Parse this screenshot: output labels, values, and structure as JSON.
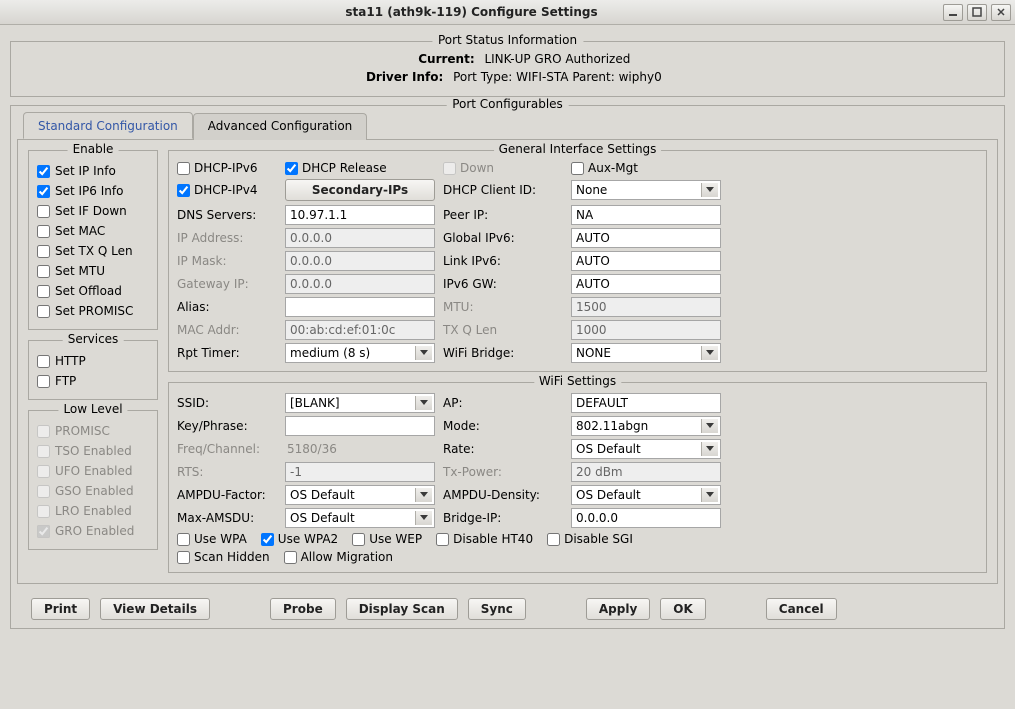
{
  "window": {
    "title": "sta11  (ath9k-119) Configure Settings"
  },
  "port_status": {
    "title": "Port Status Information",
    "current_label": "Current:",
    "current_value": "LINK-UP GRO  Authorized",
    "driver_label": "Driver Info:",
    "driver_value": "Port Type: WIFI-STA   Parent: wiphy0"
  },
  "configurables_title": "Port Configurables",
  "tabs": {
    "standard": "Standard Configuration",
    "advanced": "Advanced Configuration"
  },
  "enable": {
    "legend": "Enable",
    "items": [
      {
        "label": "Set IP Info",
        "checked": true,
        "enabled": true
      },
      {
        "label": "Set IP6 Info",
        "checked": true,
        "enabled": true
      },
      {
        "label": "Set IF Down",
        "checked": false,
        "enabled": true
      },
      {
        "label": "Set MAC",
        "checked": false,
        "enabled": true
      },
      {
        "label": "Set TX Q Len",
        "checked": false,
        "enabled": true
      },
      {
        "label": "Set MTU",
        "checked": false,
        "enabled": true
      },
      {
        "label": "Set Offload",
        "checked": false,
        "enabled": true
      },
      {
        "label": "Set PROMISC",
        "checked": false,
        "enabled": true
      }
    ]
  },
  "services": {
    "legend": "Services",
    "items": [
      {
        "label": "HTTP",
        "checked": false,
        "enabled": true
      },
      {
        "label": "FTP",
        "checked": false,
        "enabled": true
      }
    ]
  },
  "lowlevel": {
    "legend": "Low Level",
    "items": [
      {
        "label": "PROMISC",
        "checked": false,
        "enabled": false
      },
      {
        "label": "TSO Enabled",
        "checked": false,
        "enabled": false
      },
      {
        "label": "UFO Enabled",
        "checked": false,
        "enabled": false
      },
      {
        "label": "GSO Enabled",
        "checked": false,
        "enabled": false
      },
      {
        "label": "LRO Enabled",
        "checked": false,
        "enabled": false
      },
      {
        "label": "GRO Enabled",
        "checked": true,
        "enabled": false
      }
    ]
  },
  "general": {
    "title": "General Interface Settings",
    "dhcp_ipv6": {
      "label": "DHCP-IPv6",
      "checked": false,
      "enabled": true
    },
    "dhcp_release": {
      "label": "DHCP Release",
      "checked": true,
      "enabled": true
    },
    "down": {
      "label": "Down",
      "checked": false,
      "enabled": false
    },
    "aux_mgt": {
      "label": "Aux-Mgt",
      "checked": false,
      "enabled": true
    },
    "dhcp_ipv4": {
      "label": "DHCP-IPv4",
      "checked": true,
      "enabled": true
    },
    "secondary_ips_btn": "Secondary-IPs",
    "dhcp_client_id_label": "DHCP Client ID:",
    "dhcp_client_id_value": "None",
    "dns_label": "DNS Servers:",
    "dns_value": "10.97.1.1",
    "peer_label": "Peer IP:",
    "peer_value": "NA",
    "ip_label": "IP Address:",
    "ip_value": "0.0.0.0",
    "gipv6_label": "Global IPv6:",
    "gipv6_value": "AUTO",
    "mask_label": "IP Mask:",
    "mask_value": "0.0.0.0",
    "lipv6_label": "Link IPv6:",
    "lipv6_value": "AUTO",
    "gw_label": "Gateway IP:",
    "gw_value": "0.0.0.0",
    "ipv6gw_label": "IPv6 GW:",
    "ipv6gw_value": "AUTO",
    "alias_label": "Alias:",
    "alias_value": "",
    "mtu_label": "MTU:",
    "mtu_value": "1500",
    "mac_label": "MAC Addr:",
    "mac_value": "00:ab:cd:ef:01:0c",
    "txq_label": "TX Q Len",
    "txq_value": "1000",
    "rpt_label": "Rpt Timer:",
    "rpt_value": "medium  (8 s)",
    "bridge_label": "WiFi Bridge:",
    "bridge_value": "NONE"
  },
  "wifi": {
    "title": "WiFi Settings",
    "ssid_label": "SSID:",
    "ssid_value": "[BLANK]",
    "ap_label": "AP:",
    "ap_value": "DEFAULT",
    "key_label": "Key/Phrase:",
    "key_value": "",
    "mode_label": "Mode:",
    "mode_value": "802.11abgn",
    "freq_label": "Freq/Channel:",
    "freq_value": "5180/36",
    "rate_label": "Rate:",
    "rate_value": "OS Default",
    "rts_label": "RTS:",
    "rts_value": "-1",
    "txpower_label": "Tx-Power:",
    "txpower_value": "20 dBm",
    "ampduf_label": "AMPDU-Factor:",
    "ampduf_value": "OS Default",
    "ampdud_label": "AMPDU-Density:",
    "ampdud_value": "OS Default",
    "maxamsdu_label": "Max-AMSDU:",
    "maxamsdu_value": "OS Default",
    "bridgeip_label": "Bridge-IP:",
    "bridgeip_value": "0.0.0.0",
    "cb": {
      "use_wpa": {
        "label": "Use WPA",
        "checked": false
      },
      "use_wpa2": {
        "label": "Use WPA2",
        "checked": true
      },
      "use_wep": {
        "label": "Use WEP",
        "checked": false
      },
      "disable_ht40": {
        "label": "Disable HT40",
        "checked": false
      },
      "disable_sgi": {
        "label": "Disable SGI",
        "checked": false
      },
      "scan_hidden": {
        "label": "Scan Hidden",
        "checked": false
      },
      "allow_migration": {
        "label": "Allow Migration",
        "checked": false
      }
    }
  },
  "footer": {
    "print": "Print",
    "view_details": "View Details",
    "probe": "Probe",
    "display_scan": "Display Scan",
    "sync": "Sync",
    "apply": "Apply",
    "ok": "OK",
    "cancel": "Cancel"
  }
}
